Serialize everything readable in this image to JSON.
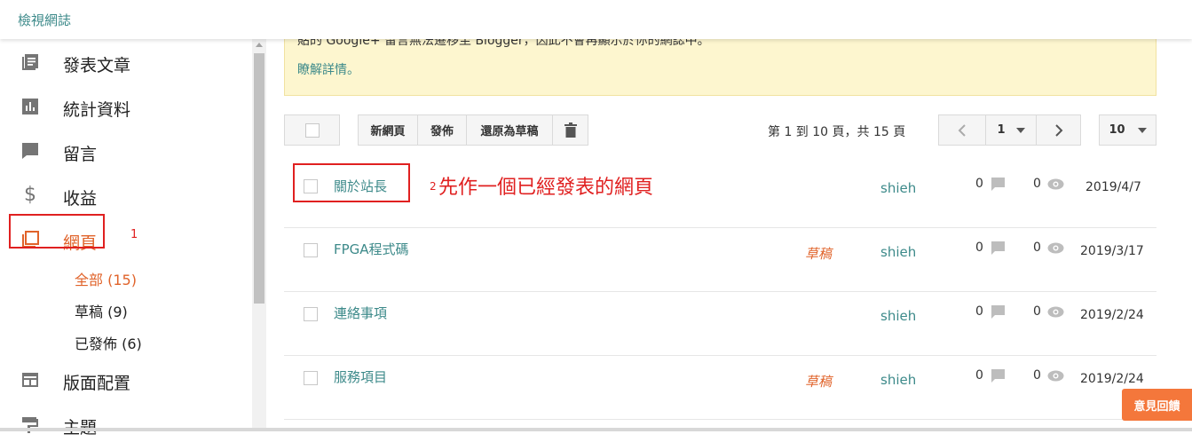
{
  "topbar": {
    "view_blog": "檢視網誌"
  },
  "sidebar": {
    "items": [
      {
        "label": "發表文章",
        "icon": "posts-icon"
      },
      {
        "label": "統計資料",
        "icon": "stats-icon"
      },
      {
        "label": "留言",
        "icon": "comments-icon"
      },
      {
        "label": "收益",
        "icon": "earnings-icon"
      },
      {
        "label": "網頁",
        "icon": "pages-icon"
      },
      {
        "label": "版面配置",
        "icon": "layout-icon"
      },
      {
        "label": "主題",
        "icon": "theme-icon"
      }
    ],
    "sub_items": [
      {
        "label": "全部 (15)"
      },
      {
        "label": "草稿 (9)"
      },
      {
        "label": "已發佈 (6)"
      }
    ]
  },
  "notice": {
    "text": "貼的 Google+ 留言無法遷移至 Blogger，因此不會再顯示於你的網誌中。",
    "more": "瞭解詳情。"
  },
  "toolbar": {
    "new_page": "新網頁",
    "publish": "發佈",
    "revert": "還原為草稿"
  },
  "pager": {
    "range_text": "第 1 到 10 頁，共 15 頁",
    "current_page": "1",
    "page_size": "10"
  },
  "rows": [
    {
      "title": "關於站長",
      "status": "",
      "author": "shieh",
      "comments": "0",
      "views": "0",
      "date": "2019/4/7"
    },
    {
      "title": "FPGA程式碼",
      "status": "草稿",
      "author": "shieh",
      "comments": "0",
      "views": "0",
      "date": "2019/3/17"
    },
    {
      "title": "連絡事項",
      "status": "",
      "author": "shieh",
      "comments": "0",
      "views": "0",
      "date": "2019/2/24"
    },
    {
      "title": "服務項目",
      "status": "草稿",
      "author": "shieh",
      "comments": "0",
      "views": "0",
      "date": "2019/2/24"
    }
  ],
  "annotations": {
    "step1": "1",
    "step2_num": "2",
    "step2_text": "先作一個已經發表的網頁"
  },
  "feedback": {
    "label": "意見回饋"
  },
  "colors": {
    "accent": "#e0632a",
    "link": "#3d8a8a",
    "notice_bg": "#fdf6cf",
    "annotation": "#e02020"
  }
}
